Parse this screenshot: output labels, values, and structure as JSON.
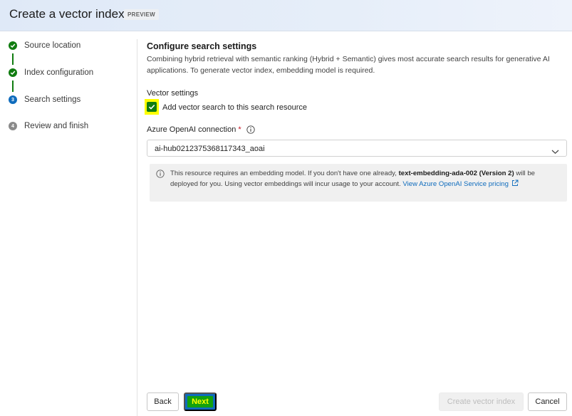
{
  "header": {
    "title": "Create a vector index",
    "badge": "PREVIEW"
  },
  "steps": [
    {
      "label": "Source location",
      "status": "done",
      "marker": ""
    },
    {
      "label": "Index configuration",
      "status": "done",
      "marker": ""
    },
    {
      "label": "Search settings",
      "status": "current",
      "marker": "3"
    },
    {
      "label": "Review and finish",
      "status": "todo",
      "marker": "4"
    }
  ],
  "main": {
    "title": "Configure search settings",
    "description": "Combining hybrid retrieval with semantic ranking (Hybrid + Semantic) gives most accurate search results for generative AI applications. To generate vector index, embedding model is required.",
    "vector_settings_label": "Vector settings",
    "checkbox_label": "Add vector search to this search resource",
    "checkbox_checked": true,
    "connection_label": "Azure OpenAI connection",
    "required_mark": "*",
    "connection_value": "ai-hub0212375368117343_aoai",
    "info": {
      "text_before": "This resource requires an embedding model. If you don't have one already,",
      "model_name": "text-embedding-ada-002 (Version 2)",
      "text_after": "will be deployed for you. Using vector embeddings will incur usage to your account.",
      "link_text": "View Azure OpenAI Service pricing"
    }
  },
  "footer": {
    "back_label": "Back",
    "next_label": "Next",
    "create_label": "Create vector index",
    "cancel_label": "Cancel"
  },
  "colors": {
    "accent": "#0f6cbd",
    "success": "#107c10",
    "highlight": "#ffff00",
    "required": "#c50f1f"
  },
  "icons": [
    "checkmark-icon",
    "info-icon",
    "chevron-down-icon",
    "open-external-icon"
  ]
}
